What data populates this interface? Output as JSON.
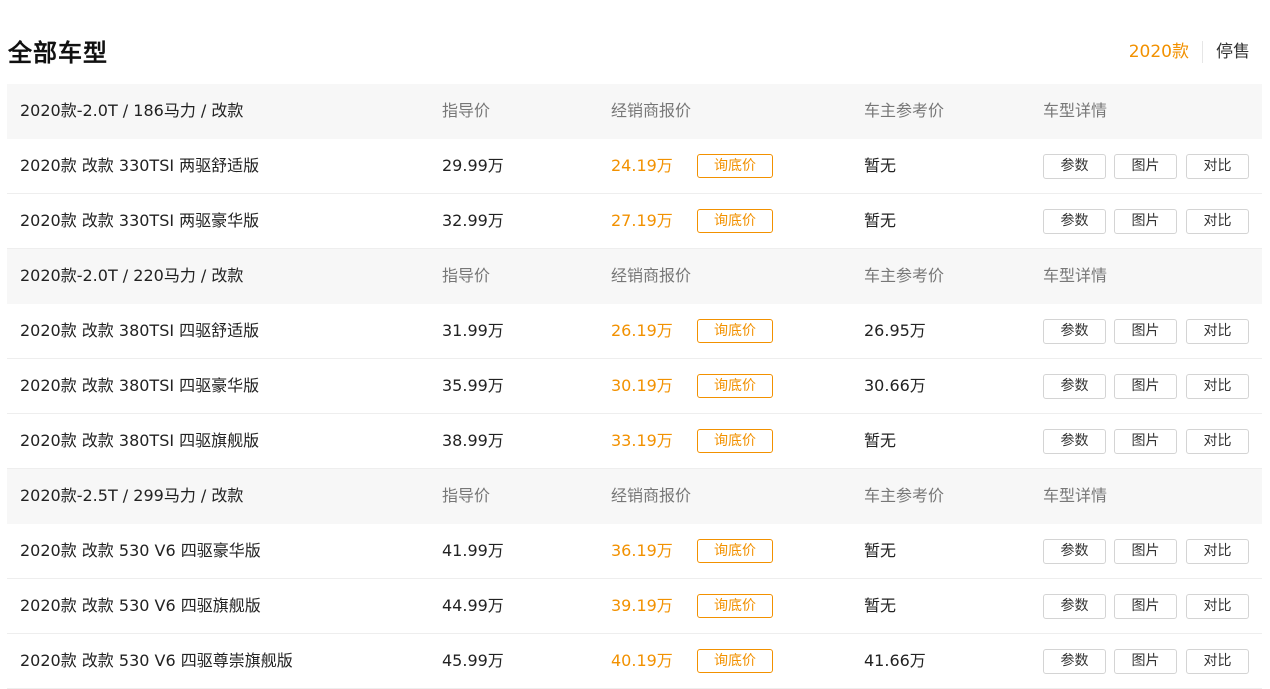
{
  "header": {
    "title": "全部车型",
    "year_tabs": [
      {
        "label": "2020款",
        "active": true
      },
      {
        "label": "停售",
        "active": false
      }
    ]
  },
  "accent_color": "#f29100",
  "groups": [
    {
      "title": "2020款-2.0T / 186马力 / 改款",
      "col_guide": "指导价",
      "col_dealer": "经销商报价",
      "col_owner": "车主参考价",
      "col_detail": "车型详情",
      "models": [
        {
          "name": "2020款 改款 330TSI 两驱舒适版",
          "guide": "29.99万",
          "dealer": "24.19万",
          "inquire": "询底价",
          "owner": "暂无",
          "btn_params": "参数",
          "btn_photos": "图片",
          "btn_compare": "对比"
        },
        {
          "name": "2020款 改款 330TSI 两驱豪华版",
          "guide": "32.99万",
          "dealer": "27.19万",
          "inquire": "询底价",
          "owner": "暂无",
          "btn_params": "参数",
          "btn_photos": "图片",
          "btn_compare": "对比"
        }
      ]
    },
    {
      "title": "2020款-2.0T / 220马力 / 改款",
      "col_guide": "指导价",
      "col_dealer": "经销商报价",
      "col_owner": "车主参考价",
      "col_detail": "车型详情",
      "models": [
        {
          "name": "2020款 改款 380TSI 四驱舒适版",
          "guide": "31.99万",
          "dealer": "26.19万",
          "inquire": "询底价",
          "owner": "26.95万",
          "btn_params": "参数",
          "btn_photos": "图片",
          "btn_compare": "对比"
        },
        {
          "name": "2020款 改款 380TSI 四驱豪华版",
          "guide": "35.99万",
          "dealer": "30.19万",
          "inquire": "询底价",
          "owner": "30.66万",
          "btn_params": "参数",
          "btn_photos": "图片",
          "btn_compare": "对比"
        },
        {
          "name": "2020款 改款 380TSI 四驱旗舰版",
          "guide": "38.99万",
          "dealer": "33.19万",
          "inquire": "询底价",
          "owner": "暂无",
          "btn_params": "参数",
          "btn_photos": "图片",
          "btn_compare": "对比"
        }
      ]
    },
    {
      "title": "2020款-2.5T / 299马力 / 改款",
      "col_guide": "指导价",
      "col_dealer": "经销商报价",
      "col_owner": "车主参考价",
      "col_detail": "车型详情",
      "models": [
        {
          "name": "2020款 改款 530 V6 四驱豪华版",
          "guide": "41.99万",
          "dealer": "36.19万",
          "inquire": "询底价",
          "owner": "暂无",
          "btn_params": "参数",
          "btn_photos": "图片",
          "btn_compare": "对比"
        },
        {
          "name": "2020款 改款 530 V6 四驱旗舰版",
          "guide": "44.99万",
          "dealer": "39.19万",
          "inquire": "询底价",
          "owner": "暂无",
          "btn_params": "参数",
          "btn_photos": "图片",
          "btn_compare": "对比"
        },
        {
          "name": "2020款 改款 530 V6 四驱尊崇旗舰版",
          "guide": "45.99万",
          "dealer": "40.19万",
          "inquire": "询底价",
          "owner": "41.66万",
          "btn_params": "参数",
          "btn_photos": "图片",
          "btn_compare": "对比"
        }
      ]
    }
  ]
}
